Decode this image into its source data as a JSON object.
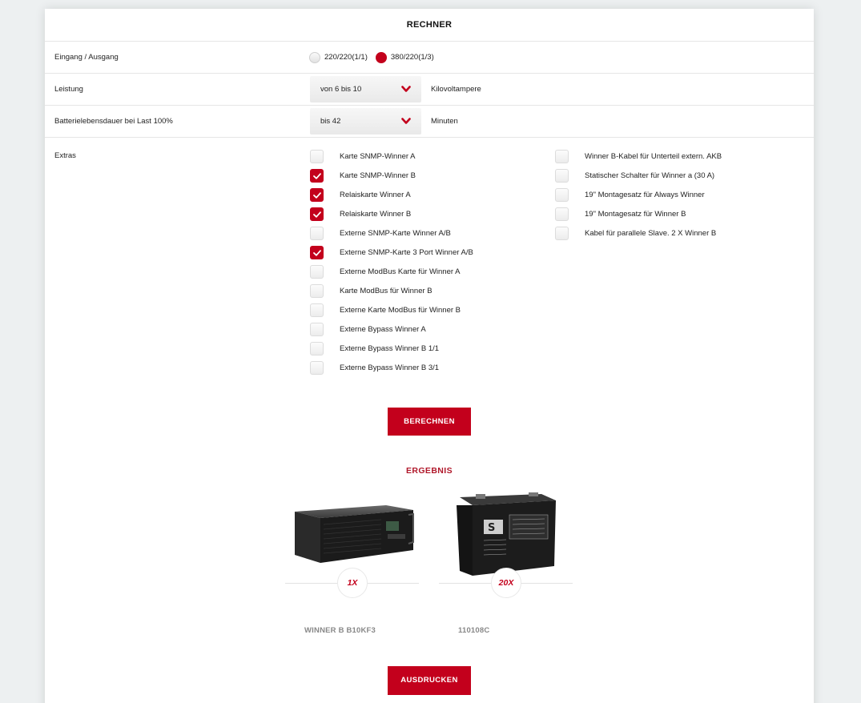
{
  "calculator": {
    "title": "RECHNER",
    "io": {
      "label": "Eingang / Ausgang",
      "options": [
        {
          "label": "220/220(1/1)",
          "checked": false
        },
        {
          "label": "380/220(1/3)",
          "checked": true
        }
      ]
    },
    "power": {
      "label": "Leistung",
      "value": "von 6 bis 10",
      "unit": "Kilovoltampere"
    },
    "battery": {
      "label": "Batterielebensdauer bei Last 100%",
      "value": "bis 42",
      "unit": "Minuten"
    },
    "extras": {
      "label": "Extras",
      "left": [
        {
          "label": "Karte SNMP-Winner A",
          "checked": false
        },
        {
          "label": "Karte SNMP-Winner B",
          "checked": true
        },
        {
          "label": "Relaiskarte Winner A",
          "checked": true
        },
        {
          "label": "Relaiskarte Winner B",
          "checked": true
        },
        {
          "label": "Externe SNMP-Karte Winner A/B",
          "checked": false
        },
        {
          "label": "Externe SNMP-Karte 3 Port Winner A/B",
          "checked": true
        },
        {
          "label": "Externe ModBus Karte für Winner A",
          "checked": false
        },
        {
          "label": "Karte ModBus für Winner B",
          "checked": false
        },
        {
          "label": "Externe Karte ModBus für Winner B",
          "checked": false
        },
        {
          "label": "Externe Bypass Winner A",
          "checked": false
        },
        {
          "label": "Externe Bypass Winner B 1/1",
          "checked": false
        },
        {
          "label": "Externe Bypass Winner B 3/1",
          "checked": false
        }
      ],
      "right": [
        {
          "label": "Winner B-Kabel für Unterteil extern. AKB",
          "checked": false
        },
        {
          "label": "Statischer Schalter für Winner a (30 A)",
          "checked": false
        },
        {
          "label": "19\" Montagesatz für Always Winner",
          "checked": false
        },
        {
          "label": "19\" Montagesatz für Winner B",
          "checked": false
        },
        {
          "label": "Kabel für parallele Slave. 2 X Winner B",
          "checked": false
        }
      ]
    },
    "calculate_label": "BERECHNEN"
  },
  "result": {
    "title": "ERGEBNIS",
    "products": [
      {
        "name": "WINNER B B10KF3",
        "qty": "1X"
      },
      {
        "name": "110108C",
        "qty": "20X"
      }
    ],
    "print_label": "AUSDRUCKEN"
  },
  "colors": {
    "accent": "#c3001c",
    "result_title": "#b0172a"
  }
}
